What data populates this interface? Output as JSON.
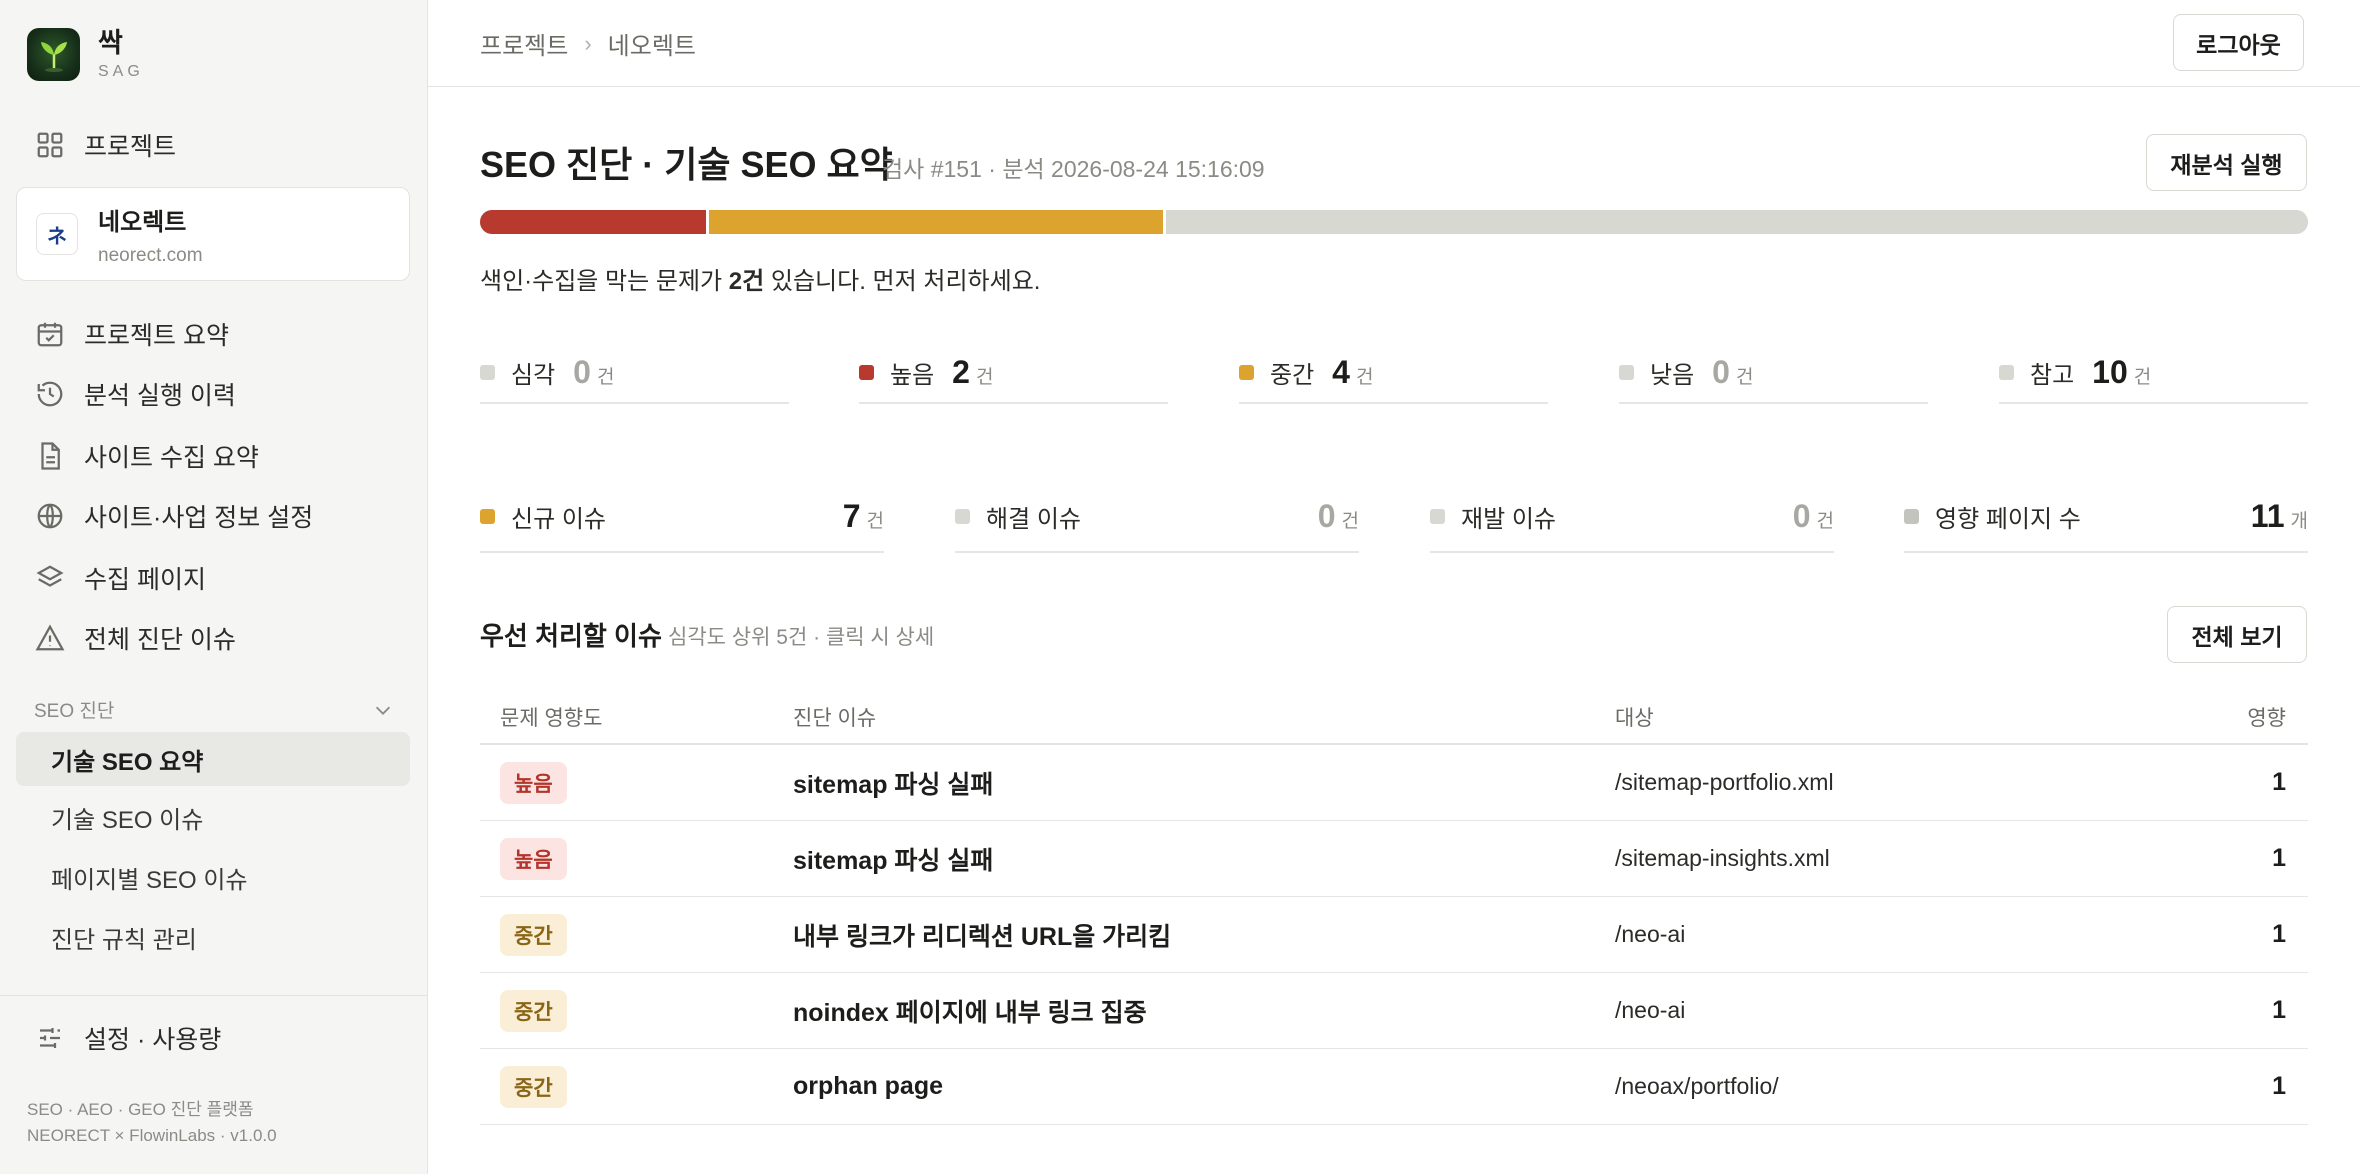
{
  "sidebar": {
    "brand": {
      "name": "싹",
      "sub": "SAG"
    },
    "projects_label": "프로젝트",
    "project": {
      "name": "네오렉트",
      "domain": "neorect.com",
      "logo_text": "ネ"
    },
    "nav": [
      {
        "label": "프로젝트 요약",
        "icon": "calendar-check-icon"
      },
      {
        "label": "분석 실행 이력",
        "icon": "history-icon"
      },
      {
        "label": "사이트 수집 요약",
        "icon": "document-icon"
      },
      {
        "label": "사이트·사업 정보 설정",
        "icon": "globe-icon"
      },
      {
        "label": "수집 페이지",
        "icon": "layers-icon"
      },
      {
        "label": "전체 진단 이슈",
        "icon": "warning-icon"
      }
    ],
    "section": "SEO 진단",
    "sub_items": [
      {
        "label": "기술 SEO 요약",
        "active": true
      },
      {
        "label": "기술 SEO 이슈",
        "active": false
      },
      {
        "label": "페이지별 SEO 이슈",
        "active": false
      },
      {
        "label": "진단 규칙 관리",
        "active": false
      }
    ],
    "settings_label": "설정 · 사용량",
    "footer_line1": "SEO · AEO · GEO 진단 플랫폼",
    "footer_line2": "NEORECT × FlowinLabs · v1.0.0"
  },
  "topbar": {
    "breadcrumb": [
      "프로젝트",
      "네오렉트"
    ],
    "separator": "›",
    "logout_label": "로그아웃"
  },
  "main": {
    "title": "SEO 진단 · 기술 SEO 요약",
    "meta": "검사 #151 · 분석 2026-08-24 15:16:09",
    "rerun_label": "재분석 실행",
    "severity_bar": [
      {
        "name": "높음",
        "fraction": 0.125,
        "color": "#b83a2e"
      },
      {
        "name": "중간",
        "fraction": 0.25,
        "color": "#dca42e"
      },
      {
        "name": "참고",
        "fraction": 0.625,
        "color": "#d8d8d3"
      }
    ],
    "summary": {
      "pre": "색인·수집을 막는 문제가 ",
      "count": "2건",
      "post": " 있습니다. 먼저 처리하세요."
    },
    "stats": [
      {
        "label": "심각",
        "value": "0",
        "unit": "건",
        "color": "#d8d8d3",
        "zero": true
      },
      {
        "label": "높음",
        "value": "2",
        "unit": "건",
        "color": "#b83a2e",
        "zero": false
      },
      {
        "label": "중간",
        "value": "4",
        "unit": "건",
        "color": "#dca42e",
        "zero": false
      },
      {
        "label": "낮음",
        "value": "0",
        "unit": "건",
        "color": "#d8d8d3",
        "zero": true
      },
      {
        "label": "참고",
        "value": "10",
        "unit": "건",
        "color": "#d8d8d3",
        "zero": false
      }
    ],
    "metrics": [
      {
        "label": "신규 이슈",
        "value": "7",
        "unit": "건",
        "color": "#dca42e",
        "zero": false
      },
      {
        "label": "해결 이슈",
        "value": "0",
        "unit": "건",
        "color": "#d8d8d3",
        "zero": true
      },
      {
        "label": "재발 이슈",
        "value": "0",
        "unit": "건",
        "color": "#d8d8d3",
        "zero": true
      },
      {
        "label": "영향 페이지 수",
        "value": "11",
        "unit": "개",
        "color": "#c4c4bf",
        "zero": false
      }
    ],
    "priority": {
      "title": "우선 처리할 이슈",
      "subtitle": "심각도 상위 5건 · 클릭 시 상세",
      "view_all_label": "전체 보기",
      "columns": [
        "문제 영향도",
        "진단 이슈",
        "대상",
        "영향"
      ],
      "rows": [
        {
          "severity": "높음",
          "level": "high",
          "issue": "sitemap 파싱 실패",
          "target": "/sitemap-portfolio.xml",
          "impact": "1"
        },
        {
          "severity": "높음",
          "level": "high",
          "issue": "sitemap 파싱 실패",
          "target": "/sitemap-insights.xml",
          "impact": "1"
        },
        {
          "severity": "중간",
          "level": "mid",
          "issue": "내부 링크가 리디렉션 URL을 가리킴",
          "target": "/neo-ai",
          "impact": "1"
        },
        {
          "severity": "중간",
          "level": "mid",
          "issue": "noindex 페이지에 내부 링크 집중",
          "target": "/neo-ai",
          "impact": "1"
        },
        {
          "severity": "중간",
          "level": "mid",
          "issue": "orphan page",
          "target": "/neoax/portfolio/",
          "impact": "1"
        }
      ]
    }
  }
}
